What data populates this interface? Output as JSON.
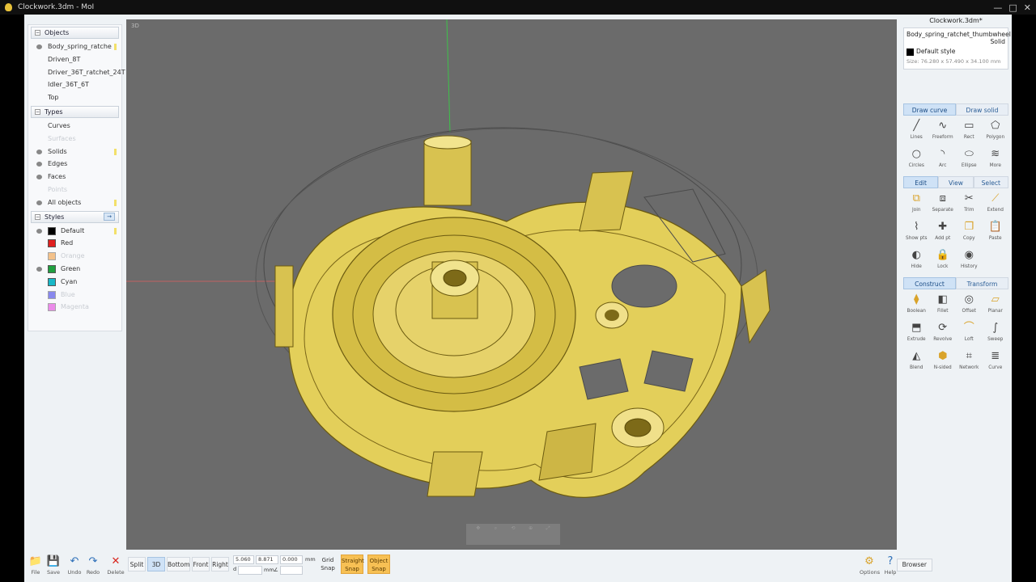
{
  "window": {
    "title": "Clockwork.3dm - MoI",
    "controls": [
      "—",
      "□",
      "✕"
    ]
  },
  "objects": {
    "header": "Objects",
    "items": [
      {
        "label": "Body_spring_ratche",
        "visible": true,
        "selected": true
      },
      {
        "label": "Driven_8T",
        "visible": false
      },
      {
        "label": "Driver_36T_ratchet_24T",
        "visible": false
      },
      {
        "label": "Idler_36T_6T",
        "visible": false
      },
      {
        "label": "Top",
        "visible": false
      }
    ]
  },
  "types": {
    "header": "Types",
    "items": [
      {
        "label": "Curves",
        "dim": false
      },
      {
        "label": "Surfaces",
        "dim": true
      },
      {
        "label": "Solids",
        "dim": false
      },
      {
        "label": "Edges",
        "dim": false
      },
      {
        "label": "Faces",
        "dim": false
      },
      {
        "label": "Points",
        "dim": true
      },
      {
        "label": "All objects",
        "dim": false
      }
    ]
  },
  "styles": {
    "header": "Styles",
    "arrow": "→",
    "items": [
      {
        "label": "Default",
        "color": "#000000",
        "dim": false
      },
      {
        "label": "Red",
        "color": "#e02020",
        "dim": false
      },
      {
        "label": "Orange",
        "color": "#f08a1c",
        "dim": true
      },
      {
        "label": "Green",
        "color": "#20a040",
        "dim": false
      },
      {
        "label": "Cyan",
        "color": "#18b8c8",
        "dim": false
      },
      {
        "label": "Blue",
        "color": "#1a1ae0",
        "dim": true
      },
      {
        "label": "Magenta",
        "color": "#e020d8",
        "dim": true
      }
    ]
  },
  "viewport": {
    "label": "3D",
    "model_color": "#e8d66a"
  },
  "properties": {
    "doc_title": "Clockwork.3dm*",
    "name": "Body_spring_ratchet_thumbwheel",
    "type": "Solid",
    "style": "Default style",
    "size": "Size: 76.280 x 57.490 x 34.100 mm"
  },
  "draw_tabs": [
    "Draw curve",
    "Draw solid"
  ],
  "draw_tools": [
    {
      "label": "Lines",
      "icon": "╱"
    },
    {
      "label": "Freeform",
      "icon": "∿"
    },
    {
      "label": "Rect",
      "icon": "▭"
    },
    {
      "label": "Polygon",
      "icon": "⬠"
    },
    {
      "label": "Circles",
      "icon": "○"
    },
    {
      "label": "Arc",
      "icon": "◝"
    },
    {
      "label": "Ellipse",
      "icon": "⬭"
    },
    {
      "label": "More",
      "icon": "≋"
    }
  ],
  "edit_tabs": [
    "Edit",
    "View",
    "Select"
  ],
  "edit_tools": [
    {
      "label": "Join",
      "icon": "⧉"
    },
    {
      "label": "Separate",
      "icon": "⧈"
    },
    {
      "label": "Trim",
      "icon": "✂"
    },
    {
      "label": "Extend",
      "icon": "⟋"
    },
    {
      "label": "Show pts",
      "icon": "⌇"
    },
    {
      "label": "Add pt",
      "icon": "✚"
    },
    {
      "label": "Copy",
      "icon": "❐"
    },
    {
      "label": "Paste",
      "icon": "📋"
    },
    {
      "label": "Hide",
      "icon": "◐"
    },
    {
      "label": "Lock",
      "icon": "🔒"
    },
    {
      "label": "History",
      "icon": "◉"
    }
  ],
  "construct_tabs": [
    "Construct",
    "Transform"
  ],
  "construct_tools": [
    {
      "label": "Boolean",
      "icon": "⧫"
    },
    {
      "label": "Fillet",
      "icon": "◧"
    },
    {
      "label": "Offset",
      "icon": "◎"
    },
    {
      "label": "Planar",
      "icon": "▱"
    },
    {
      "label": "Extrude",
      "icon": "⬒"
    },
    {
      "label": "Revolve",
      "icon": "⟳"
    },
    {
      "label": "Loft",
      "icon": "⌒"
    },
    {
      "label": "Sweep",
      "icon": "∫"
    },
    {
      "label": "Blend",
      "icon": "◭"
    },
    {
      "label": "N-sided",
      "icon": "⬢"
    },
    {
      "label": "Network",
      "icon": "⌗"
    },
    {
      "label": "Curve",
      "icon": "≣"
    }
  ],
  "bottom": {
    "file_buttons": [
      {
        "label": "File",
        "icon": "📁"
      },
      {
        "label": "Save",
        "icon": "💾"
      },
      {
        "label": "Undo",
        "icon": "↶"
      },
      {
        "label": "Redo",
        "icon": "↷"
      },
      {
        "label": "Delete",
        "icon": "✕"
      }
    ],
    "view_buttons": [
      "Split",
      "3D",
      "Bottom",
      "Front",
      "Right"
    ],
    "coords": {
      "x": "5.060",
      "y": "8.871",
      "z": "0.000",
      "unit": "mm",
      "d": "",
      "dunit": "mm"
    },
    "snaps": [
      "Grid Snap",
      "Straight Snap",
      "Object Snap"
    ],
    "options": "Options",
    "help": "Help",
    "browser": "Browser"
  }
}
